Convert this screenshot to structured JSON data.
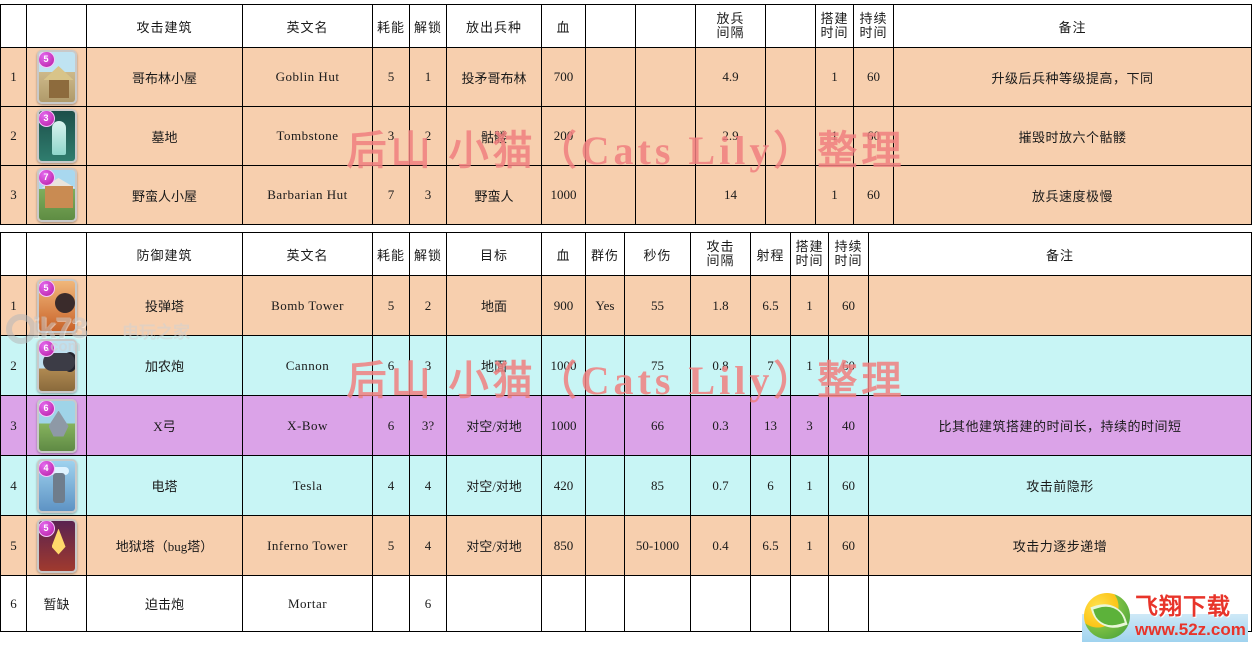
{
  "watermarks": {
    "cats_lily": "后山 小猫（Cats Lily）整理",
    "ik73_main": "ik73",
    "ik73_cn": "电玩之家",
    "ik73_url": ".com",
    "logo_title": "飞翔下载",
    "logo_url": "www.52z.com"
  },
  "attack_table": {
    "headers": {
      "index": "",
      "image": "",
      "name": "攻击建筑",
      "english": "英文名",
      "cost": "耗能",
      "unlock": "解锁",
      "troop": "放出兵种",
      "hp": "血",
      "blank1": "",
      "blank2": "",
      "spawn_interval": "放兵\n间隔",
      "spawn_interval_l1": "放兵",
      "spawn_interval_l2": "间隔",
      "blank3": "",
      "build_time_l1": "搭建",
      "build_time_l2": "时间",
      "duration_l1": "持续",
      "duration_l2": "时间",
      "note": "备注"
    },
    "rows": [
      {
        "index": "1",
        "card": "goblin-hut-card",
        "art_class": "art-goblin",
        "elixir": "5",
        "name": "哥布林小屋",
        "english": "Goblin Hut",
        "cost": "5",
        "unlock": "1",
        "troop": "投矛哥布林",
        "hp": "700",
        "blank1": "",
        "blank2": "",
        "spawn_interval": "4.9",
        "blank3": "",
        "build_time": "1",
        "duration": "60",
        "note": "升级后兵种等级提高，下同",
        "row_class": "r-peach"
      },
      {
        "index": "2",
        "card": "tombstone-card",
        "art_class": "art-tomb",
        "elixir": "3",
        "name": "墓地",
        "english": "Tombstone",
        "cost": "3",
        "unlock": "2",
        "troop": "骷髅",
        "hp": "200",
        "blank1": "",
        "blank2": "",
        "spawn_interval": "2.9",
        "blank3": "",
        "build_time": "1",
        "duration": "60",
        "note": "摧毁时放六个骷髅",
        "row_class": "r-peach"
      },
      {
        "index": "3",
        "card": "barbarian-hut-card",
        "art_class": "art-barb",
        "elixir": "7",
        "name": "野蛮人小屋",
        "english": "Barbarian Hut",
        "cost": "7",
        "unlock": "3",
        "troop": "野蛮人",
        "hp": "1000",
        "blank1": "",
        "blank2": "",
        "spawn_interval": "14",
        "blank3": "",
        "build_time": "1",
        "duration": "60",
        "note": "放兵速度极慢",
        "row_class": "r-peach"
      }
    ]
  },
  "defense_table": {
    "headers": {
      "index": "",
      "image": "",
      "name": "防御建筑",
      "english": "英文名",
      "cost": "耗能",
      "unlock": "解锁",
      "target": "目标",
      "hp": "血",
      "splash": "群伤",
      "dps": "秒伤",
      "attack_interval_l1": "攻击",
      "attack_interval_l2": "间隔",
      "range": "射程",
      "build_time_l1": "搭建",
      "build_time_l2": "时间",
      "duration_l1": "持续",
      "duration_l2": "时间",
      "note": "备注"
    },
    "rows": [
      {
        "index": "1",
        "card": "bomb-tower-card",
        "art_class": "art-bomb",
        "elixir": "5",
        "name": "投弹塔",
        "english": "Bomb Tower",
        "cost": "5",
        "unlock": "2",
        "target": "地面",
        "hp": "900",
        "splash": "Yes",
        "dps": "55",
        "attack_interval": "1.8",
        "range": "6.5",
        "build_time": "1",
        "duration": "60",
        "note": "",
        "row_class": "r-peach"
      },
      {
        "index": "2",
        "card": "cannon-card",
        "art_class": "art-cannon",
        "elixir": "6",
        "name": "加农炮",
        "english": "Cannon",
        "cost": "6",
        "unlock": "3",
        "target": "地面",
        "hp": "1000",
        "splash": "",
        "dps": "75",
        "attack_interval": "0.8",
        "range": "7",
        "build_time": "1",
        "duration": "60",
        "note": "",
        "row_class": "r-cyan"
      },
      {
        "index": "3",
        "card": "x-bow-card",
        "art_class": "art-xbow",
        "elixir": "6",
        "name": "X弓",
        "english": "X-Bow",
        "cost": "6",
        "unlock": "3?",
        "target": "对空/对地",
        "hp": "1000",
        "splash": "",
        "dps": "66",
        "attack_interval": "0.3",
        "range": "13",
        "build_time": "3",
        "duration": "40",
        "note": "比其他建筑搭建的时间长，持续的时间短",
        "row_class": "r-violet"
      },
      {
        "index": "4",
        "card": "tesla-card",
        "art_class": "art-tesla",
        "elixir": "4",
        "name": "电塔",
        "english": "Tesla",
        "cost": "4",
        "unlock": "4",
        "target": "对空/对地",
        "hp": "420",
        "splash": "",
        "dps": "85",
        "attack_interval": "0.7",
        "range": "6",
        "build_time": "1",
        "duration": "60",
        "note": "攻击前隐形",
        "row_class": "r-cyan"
      },
      {
        "index": "5",
        "card": "inferno-tower-card",
        "art_class": "art-inferno",
        "elixir": "5",
        "name": "地狱塔（bug塔）",
        "english": "Inferno Tower",
        "cost": "5",
        "unlock": "4",
        "target": "对空/对地",
        "hp": "850",
        "splash": "",
        "dps": "50-1000",
        "attack_interval": "0.4",
        "range": "6.5",
        "build_time": "1",
        "duration": "60",
        "note": "攻击力逐步递增",
        "row_class": "r-peach"
      },
      {
        "index": "6",
        "card": "",
        "art_class": "",
        "elixir": "",
        "placeholder": "暂缺",
        "name": "迫击炮",
        "english": "Mortar",
        "cost": "",
        "unlock": "6",
        "target": "",
        "hp": "",
        "splash": "",
        "dps": "",
        "attack_interval": "",
        "range": "",
        "build_time": "",
        "duration": "",
        "note": "",
        "row_class": "r-white"
      }
    ]
  }
}
